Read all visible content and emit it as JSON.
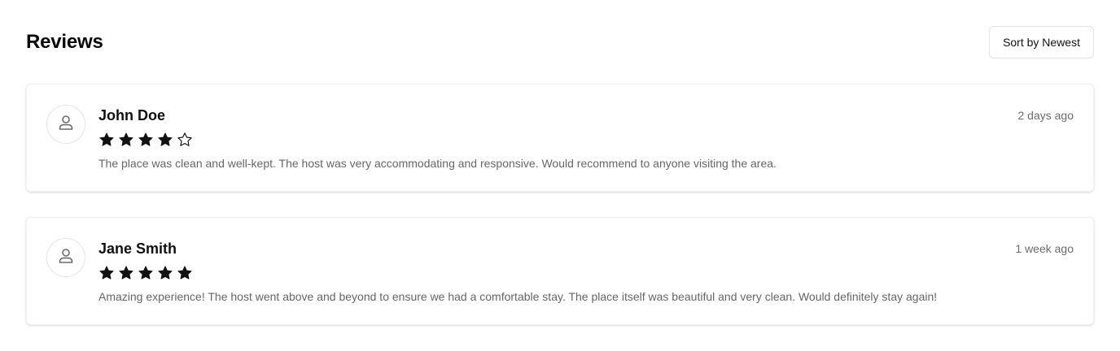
{
  "header": {
    "title": "Reviews",
    "sort_label": "Sort by Newest"
  },
  "colors": {
    "star_filled": "#111111",
    "star_empty_stroke": "#111111",
    "muted_text": "#666666"
  },
  "reviews": [
    {
      "name": "John Doe",
      "time": "2 days ago",
      "rating": 4,
      "max_rating": 5,
      "avatar_icon": "user-icon",
      "text": "The place was clean and well-kept. The host was very accommodating and responsive. Would recommend to anyone visiting the area."
    },
    {
      "name": "Jane Smith",
      "time": "1 week ago",
      "rating": 5,
      "max_rating": 5,
      "avatar_icon": "user-icon",
      "text": "Amazing experience! The host went above and beyond to ensure we had a comfortable stay. The place itself was beautiful and very clean. Would definitely stay again!"
    }
  ]
}
